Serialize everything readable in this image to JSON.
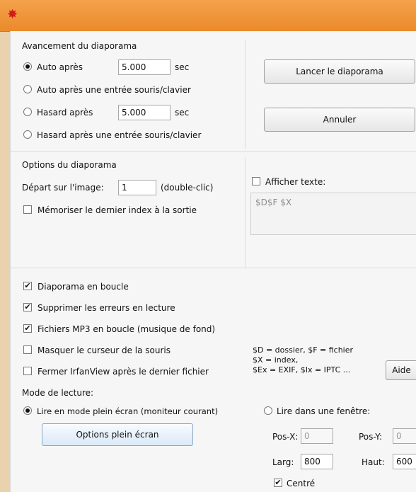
{
  "window": {
    "title_icon": "irfanview-red-star-icon"
  },
  "advancement": {
    "title": "Avancement du diaporama",
    "options": [
      {
        "label": "Auto après",
        "value": "5.000",
        "unit": "sec",
        "selected": true
      },
      {
        "label": "Auto après une entrée souris/clavier",
        "selected": false
      },
      {
        "label": "Hasard  après",
        "value": "5.000",
        "unit": "sec",
        "selected": false
      },
      {
        "label": "Hasard après une entrée souris/clavier",
        "selected": false
      }
    ]
  },
  "buttons": {
    "start": "Lancer le diaporama",
    "cancel": "Annuler",
    "help": "Aide",
    "fullscreen_options": "Options plein écran"
  },
  "options": {
    "title": "Options du diaporama",
    "start_label": "Départ sur l'image:",
    "start_value": "1",
    "dblclick_hint": "(double-clic)",
    "remember_label": "Mémoriser le dernier index à la sortie",
    "remember_checked": false,
    "show_text_label": "Afficher texte:",
    "show_text_checked": false,
    "show_text_value": "$D$F $X"
  },
  "checks": [
    {
      "label": "Diaporama en boucle",
      "checked": true
    },
    {
      "label": "Supprimer les erreurs en lecture",
      "checked": true
    },
    {
      "label": "Fichiers MP3 en boucle (musique de fond)",
      "checked": true
    },
    {
      "label": "Masquer le curseur de la souris",
      "checked": false
    },
    {
      "label": "Fermer IrfanView après le dernier fichier",
      "checked": false
    }
  ],
  "legend": {
    "line1": "$D = dossier, $F = fichier",
    "line2": "$X = index,",
    "line3": "$Ex = EXIF, $Ix = IPTC ..."
  },
  "mode": {
    "title": "Mode de lecture:",
    "fullscreen_label": "Lire en mode plein écran (moniteur courant)",
    "fullscreen_selected": true,
    "window_label": "Lire dans une fenêtre:",
    "window_selected": false,
    "posx_label": "Pos-X:",
    "posx_value": "0",
    "posy_label": "Pos-Y:",
    "posy_value": "0",
    "width_label": "Larg:",
    "width_value": "800",
    "height_label": "Haut:",
    "height_value": "600",
    "centered_label": "Centré",
    "centered_checked": true
  }
}
